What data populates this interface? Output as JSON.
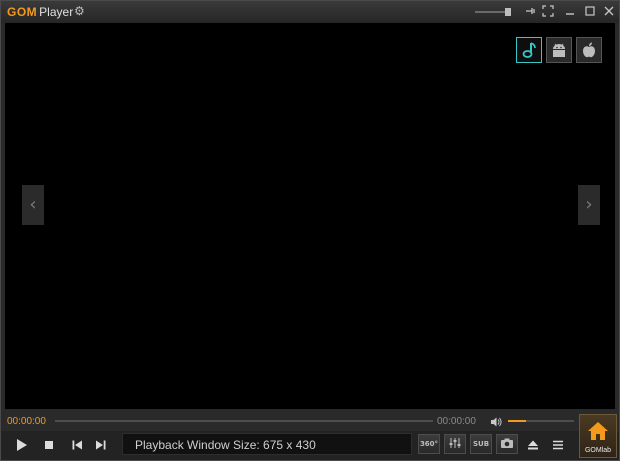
{
  "app": {
    "brand_gom": "GOM",
    "brand_player": "Player"
  },
  "title_bar": {
    "settings_icon": "gear-icon",
    "controls": [
      "mini-slider",
      "pin-icon",
      "fullscreen-icon",
      "minimize-icon",
      "maximize-icon",
      "close-icon"
    ]
  },
  "overlay": {
    "platform_icons": [
      "music-note-icon",
      "android-icon",
      "apple-icon"
    ],
    "active_platform": "music-note-icon",
    "prev_arrow": "‹",
    "next_arrow": "›"
  },
  "playback": {
    "current_time": "00:00:00",
    "total_time": "00:00:00",
    "seek_position": 0,
    "volume": 0.28
  },
  "status": {
    "text": "Playback Window Size: 675 x 430"
  },
  "buttons": {
    "vr360_label": "360°",
    "sub_label": "SUB"
  },
  "gomlab": {
    "label": "GOMlab"
  },
  "colors": {
    "accent": "#f39a1c",
    "cyan": "#39c6c6"
  }
}
